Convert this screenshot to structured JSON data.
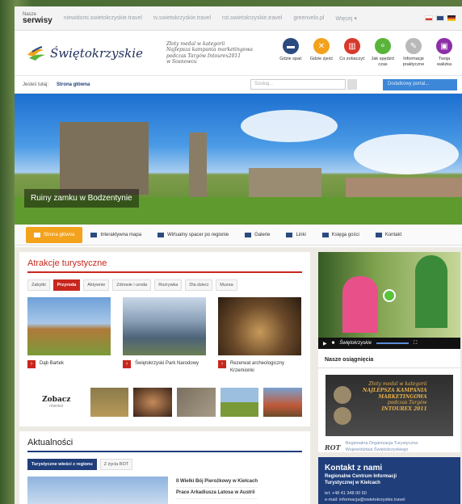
{
  "topbar": {
    "nasze": "Nasze",
    "serwisy": "serwisy",
    "links": [
      "niewidomi.swietokrzyskie.travel",
      "tv.swietokrzyskie.travel",
      "rot.swietokrzyskie.travel",
      "greenvelo.pl",
      "Więcej ▾"
    ]
  },
  "header": {
    "logo_text": "Świętokrzyskie",
    "award_lines": [
      "Złoty medal w kategorii",
      "Najlepsza kampania marketingowa",
      "podczas Targów Intourex2011",
      "w Sosnowcu"
    ],
    "icons": [
      {
        "label": "Gdzie spać",
        "color": "#2c4a80",
        "icon": "bed-icon",
        "glyph": "▬"
      },
      {
        "label": "Gdzie zjeść",
        "color": "#f3a21c",
        "icon": "cutlery-icon",
        "glyph": "✕"
      },
      {
        "label": "Co zobaczyć",
        "color": "#d7382b",
        "icon": "monument-icon",
        "glyph": "▥"
      },
      {
        "label": "Jak spędzić czas",
        "color": "#5bb43a",
        "icon": "bike-icon",
        "glyph": "⚬"
      },
      {
        "label": "Informacje praktyczne",
        "color": "#b9b9b9",
        "icon": "pencil-icon",
        "glyph": "✎"
      },
      {
        "label": "Twoja walizka",
        "color": "#8c2fa8",
        "icon": "suitcase-icon",
        "glyph": "▣"
      }
    ]
  },
  "crumb": {
    "label": "Jesteś tutaj:",
    "current": "Strona główna",
    "search_placeholder": "Szukaj...",
    "portal_select": "Dodatkowy portal..."
  },
  "hero": {
    "caption": "Ruiny zamku w Bodzentynie"
  },
  "nav": [
    {
      "label": "Strona główna",
      "active": true
    },
    {
      "label": "Interaktywna mapa"
    },
    {
      "label": "Wirtualny spacer po regionie"
    },
    {
      "label": "Galerie"
    },
    {
      "label": "Linki"
    },
    {
      "label": "Księga gości"
    },
    {
      "label": "Kontakt"
    }
  ],
  "attractions": {
    "title": "Atrakcje turystyczne",
    "tabs": [
      "Zabytki",
      "Przyroda",
      "Aktywnie",
      "Zdrowie i uroda",
      "Rozrywka",
      "Dla dzieci",
      "Muzea"
    ],
    "active_tab": "Przyroda",
    "cards": [
      {
        "title": "Dąb Bartek"
      },
      {
        "title": "Świętokrzyski Park Narodowy"
      },
      {
        "title": "Rezerwat archeologiczny Krzemionki"
      }
    ],
    "see_title": "Zobacz",
    "see_sub": "również"
  },
  "news": {
    "title": "Aktualności",
    "tabs": [
      "Turystyczne wieści z regionu",
      "Z życia ROT"
    ],
    "items": [
      "II Wielki Bój Pierożkowy w Kielcach",
      "Prace Arkadiusza Latosa w Austrii"
    ]
  },
  "side": {
    "video_brand": "Świętokrzyskie",
    "achievements_title": "Nasze osiągnięcia",
    "medal_text": [
      "Złoty medal w kategorii",
      "NAJLEPSZA KAMPANIA",
      "MARKETINGOWA",
      "podczas Targów",
      "INTOUREX 2011"
    ],
    "rot_logo": "ROT",
    "rot_text": [
      "Regionalna Organizacja Turystyczna",
      "Województwa Świętokrzyskiego"
    ]
  },
  "contact": {
    "title": "Kontakt z nami",
    "sub": [
      "Regionalne Centrum Informacji",
      "Turystycznej w Kielcach"
    ],
    "tel": "tel: +48 41 348 00 60",
    "email": "e-mail: informacja@swietokrzyskie.travel"
  }
}
